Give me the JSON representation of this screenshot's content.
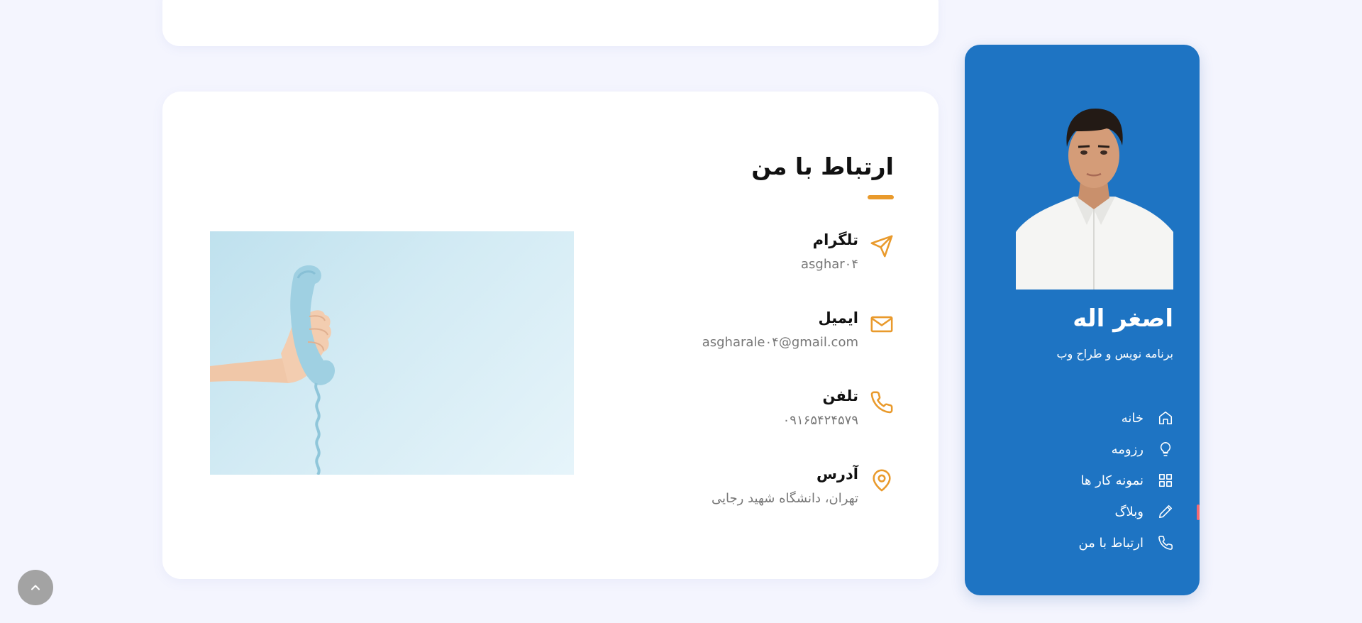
{
  "contact": {
    "title": "ارتباط با من",
    "items": [
      {
        "label": "تلگرام",
        "value": "asghar۰۴",
        "icon": "send-icon"
      },
      {
        "label": "ایمیل",
        "value": "asgharale۰۴@gmail.com",
        "icon": "mail-icon"
      },
      {
        "label": "تلفن",
        "value": "۰۹۱۶۵۴۲۴۵۷۹",
        "icon": "phone-icon"
      },
      {
        "label": "آدرس",
        "value": "تهران، دانشگاه شهید رجایی",
        "icon": "map-pin-icon"
      }
    ]
  },
  "profile": {
    "name": "اصغر اله",
    "role": "برنامه نویس و طراح وب"
  },
  "nav": {
    "items": [
      {
        "label": "خانه",
        "icon": "home-icon"
      },
      {
        "label": "رزومه",
        "icon": "lightbulb-icon"
      },
      {
        "label": "نمونه کار ها",
        "icon": "grid-icon"
      },
      {
        "label": "وبلاگ",
        "icon": "pencil-icon"
      },
      {
        "label": "ارتباط با من",
        "icon": "phone-icon"
      }
    ]
  },
  "colors": {
    "sidebar": "#1e74c3",
    "accent": "#e99a2c",
    "active_marker": "#f16a74",
    "page_bg": "#f4f5fe"
  }
}
